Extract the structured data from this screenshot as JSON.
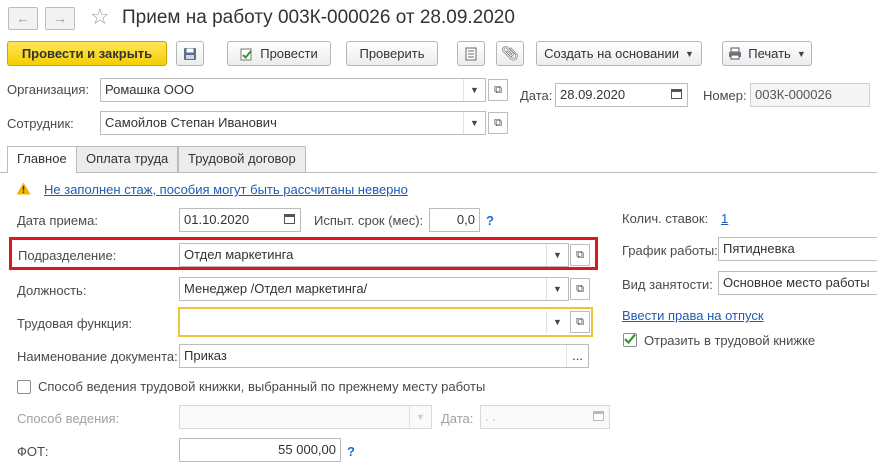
{
  "window": {
    "title": "Прием на работу 003К-000026 от 28.09.2020",
    "back_icon": "arrow-left",
    "forward_icon": "arrow-right",
    "favorite_icon": "star"
  },
  "toolbar": {
    "post_close": "Провести и закрыть",
    "post": "Провести",
    "check": "Проверить",
    "create_based": "Создать на основании",
    "print": "Печать"
  },
  "header": {
    "org_label": "Организация:",
    "org_value": "Ромашка ООО",
    "date_label": "Дата:",
    "date_value": "28.09.2020",
    "number_label": "Номер:",
    "number_value": "003К-000026",
    "employee_label": "Сотрудник:",
    "employee_value": "Самойлов Степан Иванович"
  },
  "tabs": [
    {
      "label": "Главное"
    },
    {
      "label": "Оплата труда"
    },
    {
      "label": "Трудовой договор"
    }
  ],
  "main": {
    "warning_text": "Не заполнен стаж, пособия могут быть рассчитаны неверно",
    "hire_date_label": "Дата приема:",
    "hire_date_value": "01.10.2020",
    "probation_label": "Испыт. срок (мес):",
    "probation_value": "0,0",
    "help_mark": "?",
    "division_label": "Подразделение:",
    "division_value": "Отдел маркетинга",
    "position_label": "Должность:",
    "position_value": "Менеджер /Отдел маркетинга/",
    "labor_function_label": "Трудовая функция:",
    "labor_function_value": "",
    "doc_name_label": "Наименование документа:",
    "doc_name_value": "Приказ",
    "ellipsis": "...",
    "workbook_method_check": "Способ ведения трудовой книжки, выбранный по прежнему месту работы",
    "method_label": "Способ ведения:",
    "method_date_label": "Дата:",
    "method_date_value": " .  .",
    "fot_label": "ФОТ:",
    "fot_value": "55 000,00"
  },
  "right": {
    "rates_label": "Колич. ставок:",
    "rates_value": "1",
    "schedule_label": "График работы:",
    "schedule_value": "Пятидневка",
    "employment_label": "Вид занятости:",
    "employment_value": "Основное место работы",
    "vacation_link": "Ввести права на отпуск",
    "reflect_label": "Отразить в трудовой книжке",
    "reflect_checked": true
  },
  "colors": {
    "primary_button": "#f5cf00",
    "highlight_border": "#e0161f",
    "required_border": "#f0c43a",
    "link": "#1f5bb4",
    "warning": "#f2b300"
  }
}
